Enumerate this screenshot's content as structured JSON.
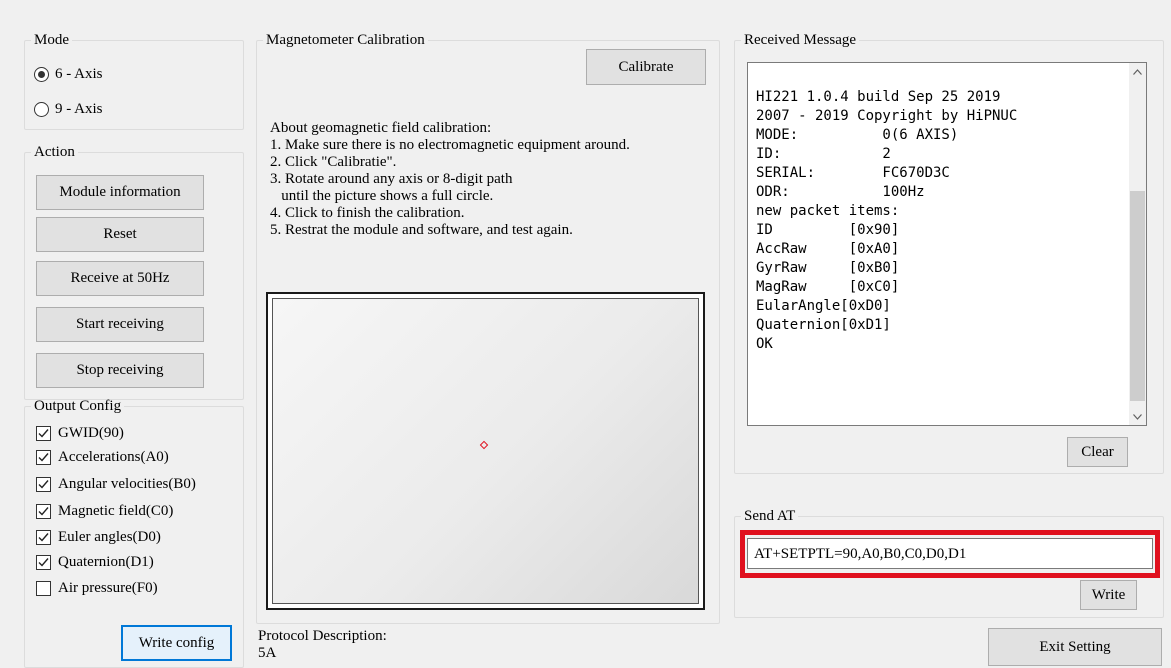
{
  "mode": {
    "title": "Mode",
    "options": [
      {
        "label": "6 - Axis",
        "selected": true
      },
      {
        "label": "9 - Axis",
        "selected": false
      }
    ]
  },
  "action": {
    "title": "Action",
    "buttons": [
      "Module information",
      "Reset",
      "Receive at  50Hz",
      "Start receiving",
      "Stop receiving"
    ]
  },
  "output_config": {
    "title": "Output Config",
    "items": [
      {
        "label": "GWID(90)",
        "checked": true
      },
      {
        "label": "Accelerations(A0)",
        "checked": true
      },
      {
        "label": "Angular velocities(B0)",
        "checked": true
      },
      {
        "label": "Magnetic field(C0)",
        "checked": true
      },
      {
        "label": "Euler angles(D0)",
        "checked": true
      },
      {
        "label": "Quaternion(D1)",
        "checked": true
      },
      {
        "label": "Air pressure(F0)",
        "checked": false
      }
    ],
    "write_button": "Write config"
  },
  "calibration": {
    "title": "Magnetometer Calibration",
    "calibrate_button": "Calibrate",
    "instructions": [
      "About geomagnetic field calibration:",
      "1. Make sure there is no electromagnetic equipment around.",
      "2. Click \"Calibratie\".",
      "3. Rotate around any axis or 8-digit path",
      "   until the picture shows a full circle.",
      "4. Click to finish the calibration.",
      "5. Restrat the module and software, and test again."
    ]
  },
  "protocol": {
    "label": "Protocol Description:",
    "value": "5A"
  },
  "received": {
    "title": "Received Message",
    "lines": [
      "",
      "HI221 1.0.4 build Sep 25 2019",
      "2007 - 2019 Copyright by HiPNUC",
      "MODE:          0(6 AXIS)",
      "ID:            2",
      "SERIAL:        FC670D3C",
      "ODR:           100Hz",
      "new packet items:",
      "ID         [0x90]",
      "AccRaw     [0xA0]",
      "GyrRaw     [0xB0]",
      "MagRaw     [0xC0]",
      "EularAngle[0xD0]",
      "Quaternion[0xD1]",
      "OK"
    ],
    "clear_button": "Clear"
  },
  "send_at": {
    "title": "Send AT",
    "value": "AT+SETPTL=90,A0,B0,C0,D0,D1",
    "write_button": "Write"
  },
  "exit_button": "Exit Setting",
  "colors": {
    "highlight": "#e0101e",
    "focus": "#0078d7"
  }
}
